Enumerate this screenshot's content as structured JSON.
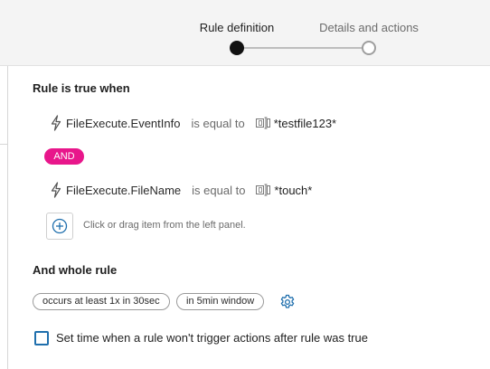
{
  "wizard": {
    "steps": [
      {
        "label": "Rule definition",
        "state": "active"
      },
      {
        "label": "Details and actions",
        "state": "inactive"
      }
    ]
  },
  "rule": {
    "heading": "Rule is true when",
    "conditions": [
      {
        "icon": "bolt-icon",
        "field": "FileExecute.EventInfo",
        "operator": "is equal to",
        "value_icon": "text-value-icon",
        "value": "*testfile123*"
      },
      {
        "icon": "bolt-icon",
        "field": "FileExecute.FileName",
        "operator": "is equal to",
        "value_icon": "text-value-icon",
        "value": "*touch*"
      }
    ],
    "connector": "AND",
    "add_hint": "Click or drag item from the left panel."
  },
  "whole_rule": {
    "heading": "And whole rule",
    "chips": [
      "occurs at least 1x in 30sec",
      "in 5min window"
    ],
    "settings_icon": "gear-icon"
  },
  "suppress": {
    "checked": false,
    "label": "Set time when a rule won't trigger actions after rule was true"
  },
  "colors": {
    "accent": "#1f6fad",
    "and_badge": "#e8168b",
    "header_bg": "#f4f4f4"
  }
}
